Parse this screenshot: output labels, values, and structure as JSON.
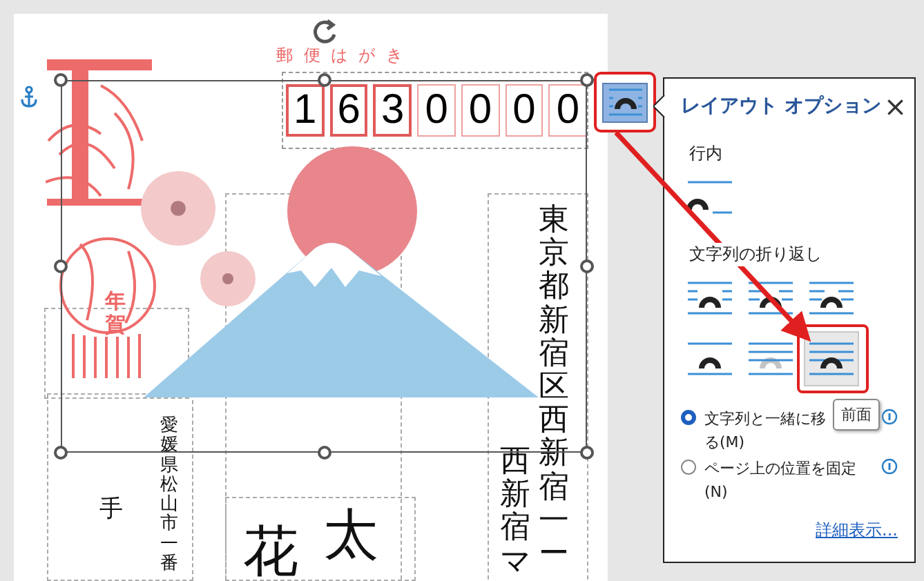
{
  "postcard": {
    "header": "郵 便 は が き",
    "postal_code": {
      "upper": [
        "1",
        "6",
        "3"
      ],
      "lower": [
        "0",
        "0",
        "0",
        "0"
      ]
    },
    "stamp_text": "年賀",
    "recipient_address": [
      "東京都新宿区西新宿一ー",
      "西新宿マ"
    ],
    "recipient_name": [
      "花",
      "太"
    ],
    "sender_address": "愛媛県松山市一番",
    "sender_name": "手"
  },
  "layout_panel": {
    "title": "レイアウト オプション",
    "close": "×",
    "inline_heading": "行内",
    "inline_options": [
      {
        "kind": "inline",
        "selected": false
      }
    ],
    "wrap_heading": "文字列の折り返し",
    "wrap_options": [
      {
        "kind": "square",
        "selected": false
      },
      {
        "kind": "tight",
        "selected": false
      },
      {
        "kind": "through",
        "selected": false
      },
      {
        "kind": "top-bottom",
        "selected": false
      },
      {
        "kind": "behind",
        "selected": false
      },
      {
        "kind": "front",
        "selected": true
      }
    ],
    "tooltip": "前面",
    "position_options": [
      {
        "lines": [
          "文字列と一緒に移",
          "る(M)"
        ],
        "selected": true
      },
      {
        "lines": [
          "ページ上の位置を固定",
          "(N)"
        ],
        "selected": false
      }
    ],
    "more_link": "詳細表示..."
  }
}
